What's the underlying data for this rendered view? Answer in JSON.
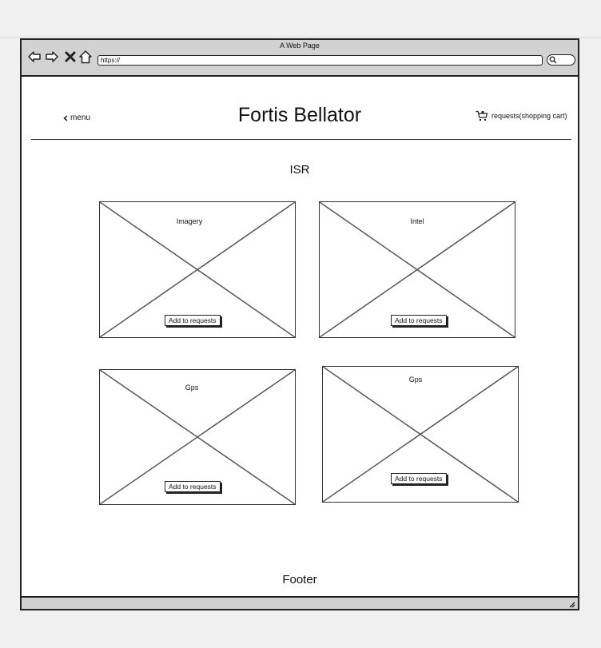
{
  "browser": {
    "window_title": "A Web Page",
    "url": "https://",
    "icons": [
      "back-arrow-icon",
      "forward-arrow-icon",
      "stop-x-icon",
      "home-icon",
      "search-icon",
      "resize-grip-icon"
    ]
  },
  "header": {
    "menu_label": "menu",
    "title": "Fortis Bellator",
    "cart_label": "requests(shopping cart)"
  },
  "section": {
    "title": "ISR",
    "cards": [
      {
        "label": "Imagery",
        "button": "Add to requests"
      },
      {
        "label": "Intel",
        "button": "Add to requests"
      },
      {
        "label": "Gps",
        "button": "Add to requests"
      },
      {
        "label": "Gps",
        "button": "Add to requests"
      }
    ]
  },
  "footer": {
    "label": "Footer"
  }
}
